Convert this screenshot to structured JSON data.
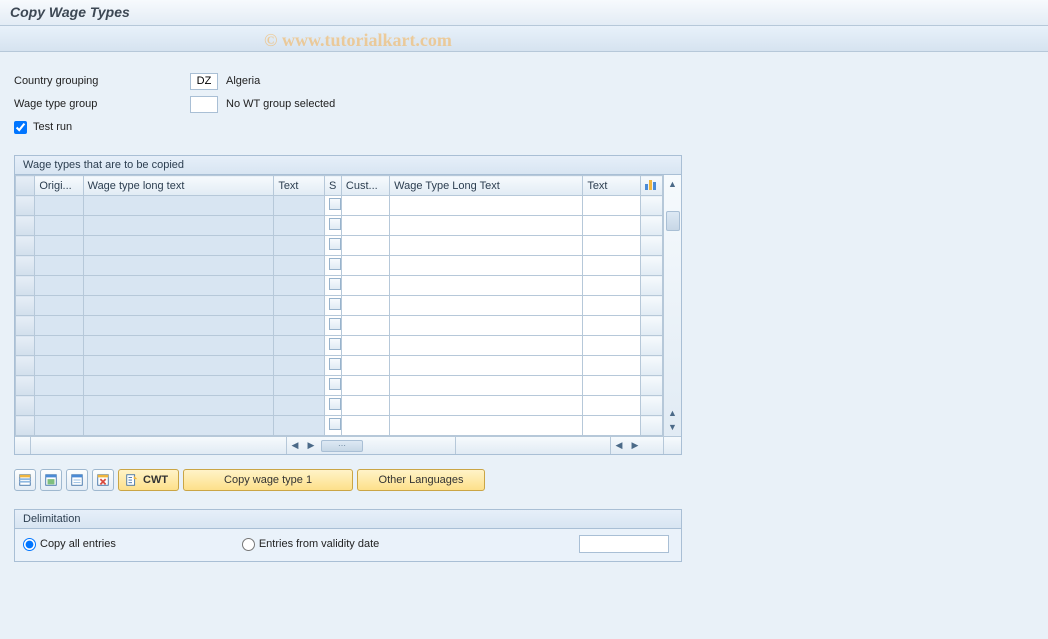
{
  "header": {
    "title": "Copy Wage Types"
  },
  "watermark": "© www.tutorialkart.com",
  "form": {
    "country_label": "Country grouping",
    "country_value": "DZ",
    "country_name": "Algeria",
    "wage_group_label": "Wage type group",
    "wage_group_value": "",
    "wage_group_name": "No WT group selected",
    "test_run_label": "Test run",
    "test_run_checked": true
  },
  "table": {
    "title": "Wage types that are to be copied",
    "columns": {
      "origi": "Origi...",
      "long1": "Wage type long text",
      "text1": "Text",
      "s": "S",
      "cust": "Cust...",
      "long2": "Wage Type Long Text",
      "text2": "Text"
    },
    "row_count": 12
  },
  "buttons": {
    "cwt": "CWT",
    "copy": "Copy wage type 1",
    "other_lang": "Other Languages"
  },
  "delimitation": {
    "title": "Delimitation",
    "copy_all": "Copy all entries",
    "from_date": "Entries from validity date",
    "selected": "copy_all",
    "date_value": ""
  }
}
